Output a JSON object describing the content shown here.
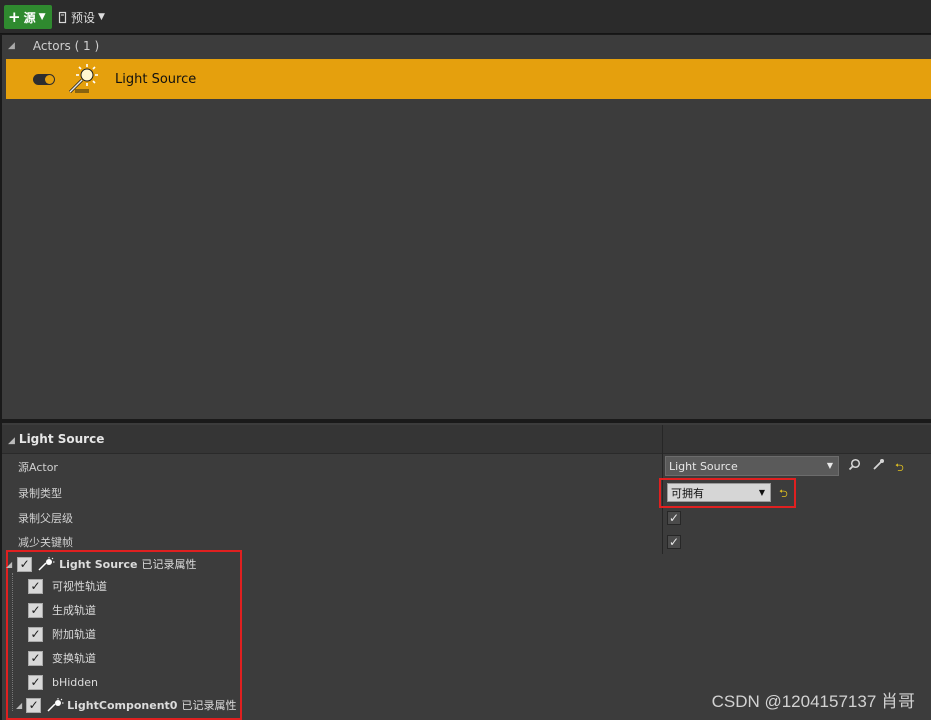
{
  "toolbar": {
    "source_button": "源",
    "preset_button": "预设"
  },
  "actors": {
    "header": "Actors ( 1 )",
    "items": [
      {
        "label": "Light Source",
        "selected": true
      }
    ]
  },
  "details": {
    "title": "Light Source",
    "properties": [
      {
        "label": "源Actor",
        "value": "Light Source"
      },
      {
        "label": "录制类型",
        "value": "可拥有"
      },
      {
        "label": "录制父层级",
        "checked": true
      },
      {
        "label": "减少关键帧",
        "checked": true
      }
    ],
    "tree": {
      "root": {
        "name": "Light Source",
        "suffix": "已记录属性"
      },
      "children": [
        {
          "label": "可视性轨道",
          "checked": true
        },
        {
          "label": "生成轨道",
          "checked": true
        },
        {
          "label": "附加轨道",
          "checked": true
        },
        {
          "label": "变换轨道",
          "checked": true
        },
        {
          "label": "bHidden",
          "checked": true
        }
      ],
      "component": {
        "name": "LightComponent0",
        "suffix": "已记录属性"
      }
    }
  },
  "watermark": "CSDN @1204157137 肖哥",
  "colors": {
    "selection": "#e5a00d",
    "source_button": "#2f8a2f",
    "highlight_box": "#e02020",
    "reset_icon": "#e0c020"
  },
  "icons": [
    "plus-icon",
    "preset-icon",
    "caret-down-icon",
    "visibility-toggle-icon",
    "light-source-icon",
    "search-icon",
    "eyedropper-icon",
    "reset-icon",
    "collapse-arrow-icon",
    "checkbox-icon"
  ]
}
